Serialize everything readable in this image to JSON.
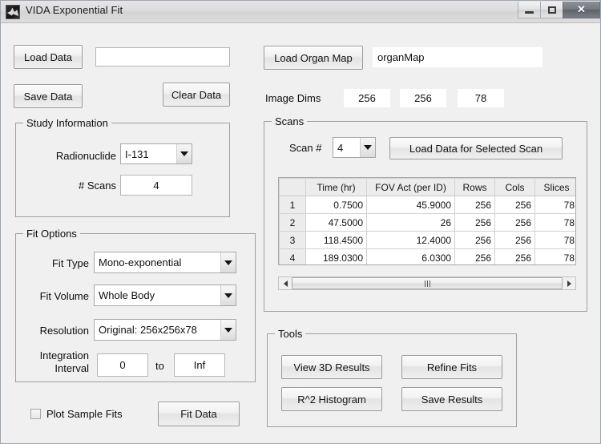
{
  "window": {
    "title": "VIDA Exponential Fit",
    "icon": "matlab-icon",
    "controls": {
      "minimize": "minimize-icon",
      "maximize": "maximize-icon",
      "close": "✕"
    }
  },
  "data_io": {
    "load_data_label": "Load Data",
    "data_path_value": "",
    "data_path_placeholder": "",
    "save_data_label": "Save Data",
    "clear_data_label": "Clear Data"
  },
  "organ": {
    "load_organ_map_label": "Load Organ Map",
    "organ_map_value": "organMap",
    "image_dims_label": "Image Dims",
    "image_dims": [
      "256",
      "256",
      "78"
    ]
  },
  "study_information": {
    "title": "Study Information",
    "radionuclide_label": "Radionuclide",
    "radionuclide_value": "I-131",
    "num_scans_label": "# Scans",
    "num_scans_value": "4"
  },
  "fit_options": {
    "title": "Fit Options",
    "fit_type_label": "Fit Type",
    "fit_type_value": "Mono-exponential",
    "fit_volume_label": "Fit Volume",
    "fit_volume_value": "Whole Body",
    "resolution_label": "Resolution",
    "resolution_value": "Original: 256x256x78",
    "integration_interval_label_line1": "Integration",
    "integration_interval_label_line2": "Interval",
    "integration_from": "0",
    "integration_to_label": "to",
    "integration_to": "Inf",
    "plot_sample_fits_label": "Plot Sample Fits",
    "plot_sample_fits_checked": false,
    "fit_data_label": "Fit Data"
  },
  "scans": {
    "title": "Scans",
    "scan_num_label": "Scan #",
    "scan_num_value": "4",
    "load_selected_label": "Load Data for Selected Scan",
    "table": {
      "headers": [
        "",
        "Time (hr)",
        "FOV Act (per ID)",
        "Rows",
        "Cols",
        "Slices"
      ],
      "rows": [
        {
          "index": "1",
          "time": "0.7500",
          "fov_act": "45.9000",
          "rows": "256",
          "cols": "256",
          "slices": "78"
        },
        {
          "index": "2",
          "time": "47.5000",
          "fov_act": "26",
          "rows": "256",
          "cols": "256",
          "slices": "78"
        },
        {
          "index": "3",
          "time": "118.4500",
          "fov_act": "12.4000",
          "rows": "256",
          "cols": "256",
          "slices": "78"
        },
        {
          "index": "4",
          "time": "189.0300",
          "fov_act": "6.0300",
          "rows": "256",
          "cols": "256",
          "slices": "78"
        }
      ]
    },
    "scrollbar": {
      "left_arrow": "scroll-left-icon",
      "right_arrow": "scroll-right-icon"
    }
  },
  "tools": {
    "title": "Tools",
    "view_3d_results_label": "View 3D Results",
    "refine_fits_label": "Refine Fits",
    "r2_histogram_label": "R^2 Histogram",
    "save_results_label": "Save Results"
  },
  "colors": {
    "window_background": "#f0f0f0",
    "titlebar": "#dcdcdc",
    "field_background": "#ffffff",
    "group_border": "#a0a0a0",
    "table_header": "#ececec"
  }
}
